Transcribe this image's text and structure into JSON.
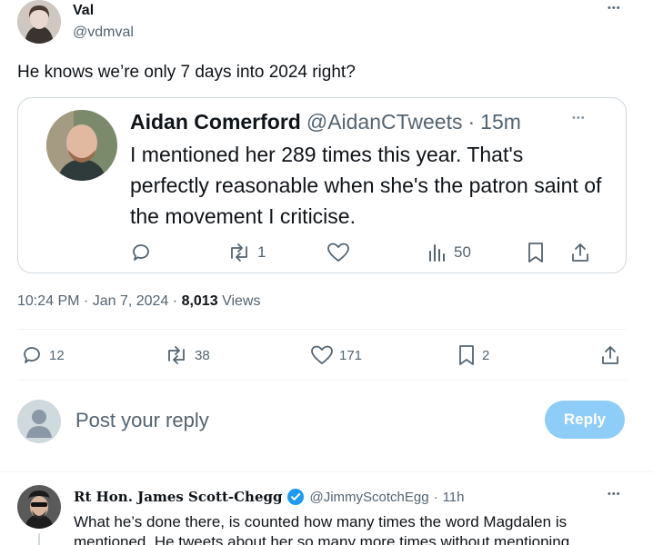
{
  "tweet": {
    "author_name": "Val",
    "author_handle": "@vdmval",
    "more_label": "•••",
    "text": "He knows we’re only 7 days into 2024 right?",
    "timestamp": "10:24 PM · Jan 7, 2024 ·",
    "views_count": "8,013",
    "views_label": "Views",
    "stats": {
      "replies": "12",
      "retweets": "38",
      "likes": "171",
      "bookmarks": "2"
    }
  },
  "quoted": {
    "author_name": "Aidan Comerford",
    "author_handle": "@AidanCTweets",
    "time_sep": "·",
    "time": "15m",
    "more_label": "•••",
    "text": "I mentioned her 289 times this year. That's perfectly reasonable when she's the patron saint of the movement I criticise.",
    "stats": {
      "retweets": "1",
      "views": "50"
    }
  },
  "reply_box": {
    "placeholder": "Post your reply",
    "button_label": "Reply"
  },
  "reply": {
    "author_name": "Rt Hon. James Scott-Chegg",
    "author_handle": "@JimmyScotchEgg",
    "time_sep": "·",
    "time": "11h",
    "more_label": "•••",
    "text": "What he’s done there, is counted how many times the word Magdalen is mentioned. He tweets about her so many more times without mentioning"
  },
  "colors": {
    "accent": "#1d9bf0",
    "reply_button": "#8ecdf8",
    "muted": "#536471",
    "border": "#cfd9de",
    "verified": "#1d9bf0"
  }
}
